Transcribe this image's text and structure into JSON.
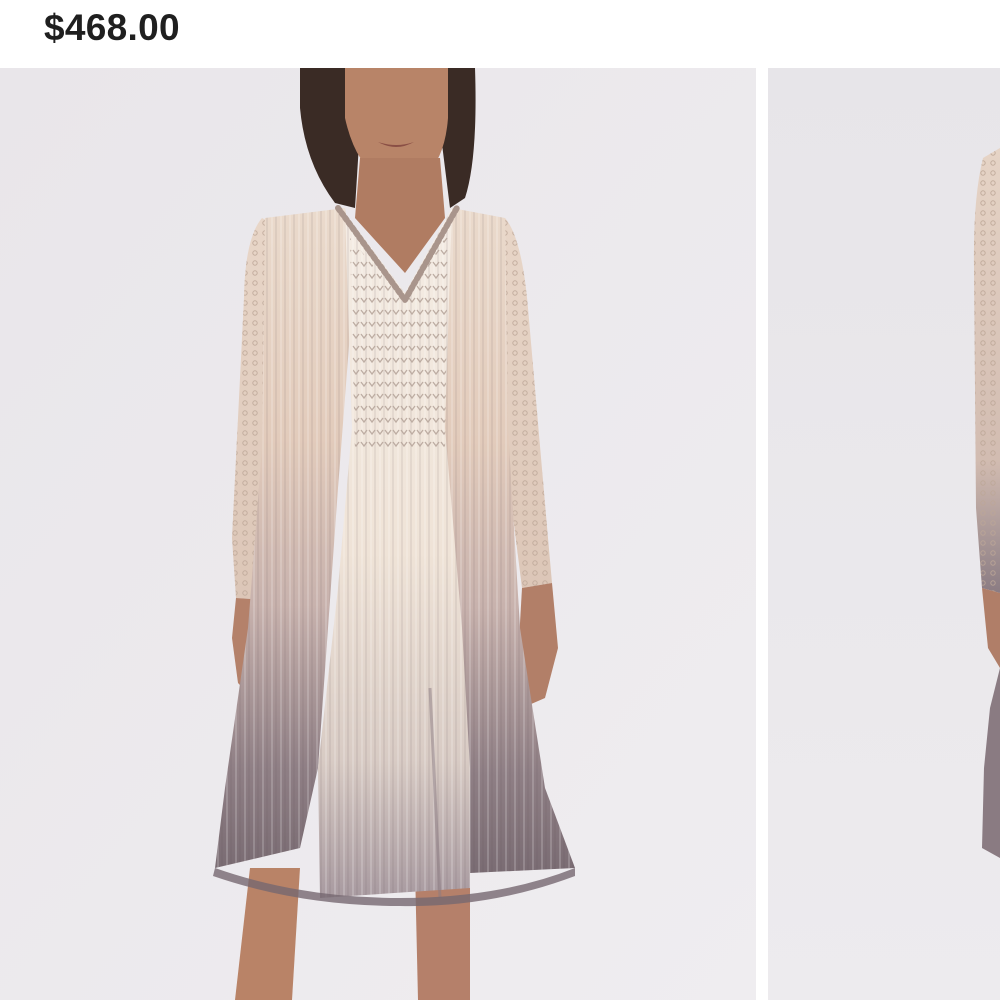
{
  "product": {
    "price": "$468.00"
  },
  "gallery": {
    "images": [
      {
        "alt": "model-front-view",
        "selected": true
      },
      {
        "alt": "model-side-view",
        "selected": false
      }
    ]
  },
  "colors": {
    "background": "#ffffff",
    "photo_backdrop": "#ebe9ec",
    "price_text": "#1f1f1f",
    "dress_top": "#e6d2c4",
    "dress_bottom": "#7d7078"
  }
}
